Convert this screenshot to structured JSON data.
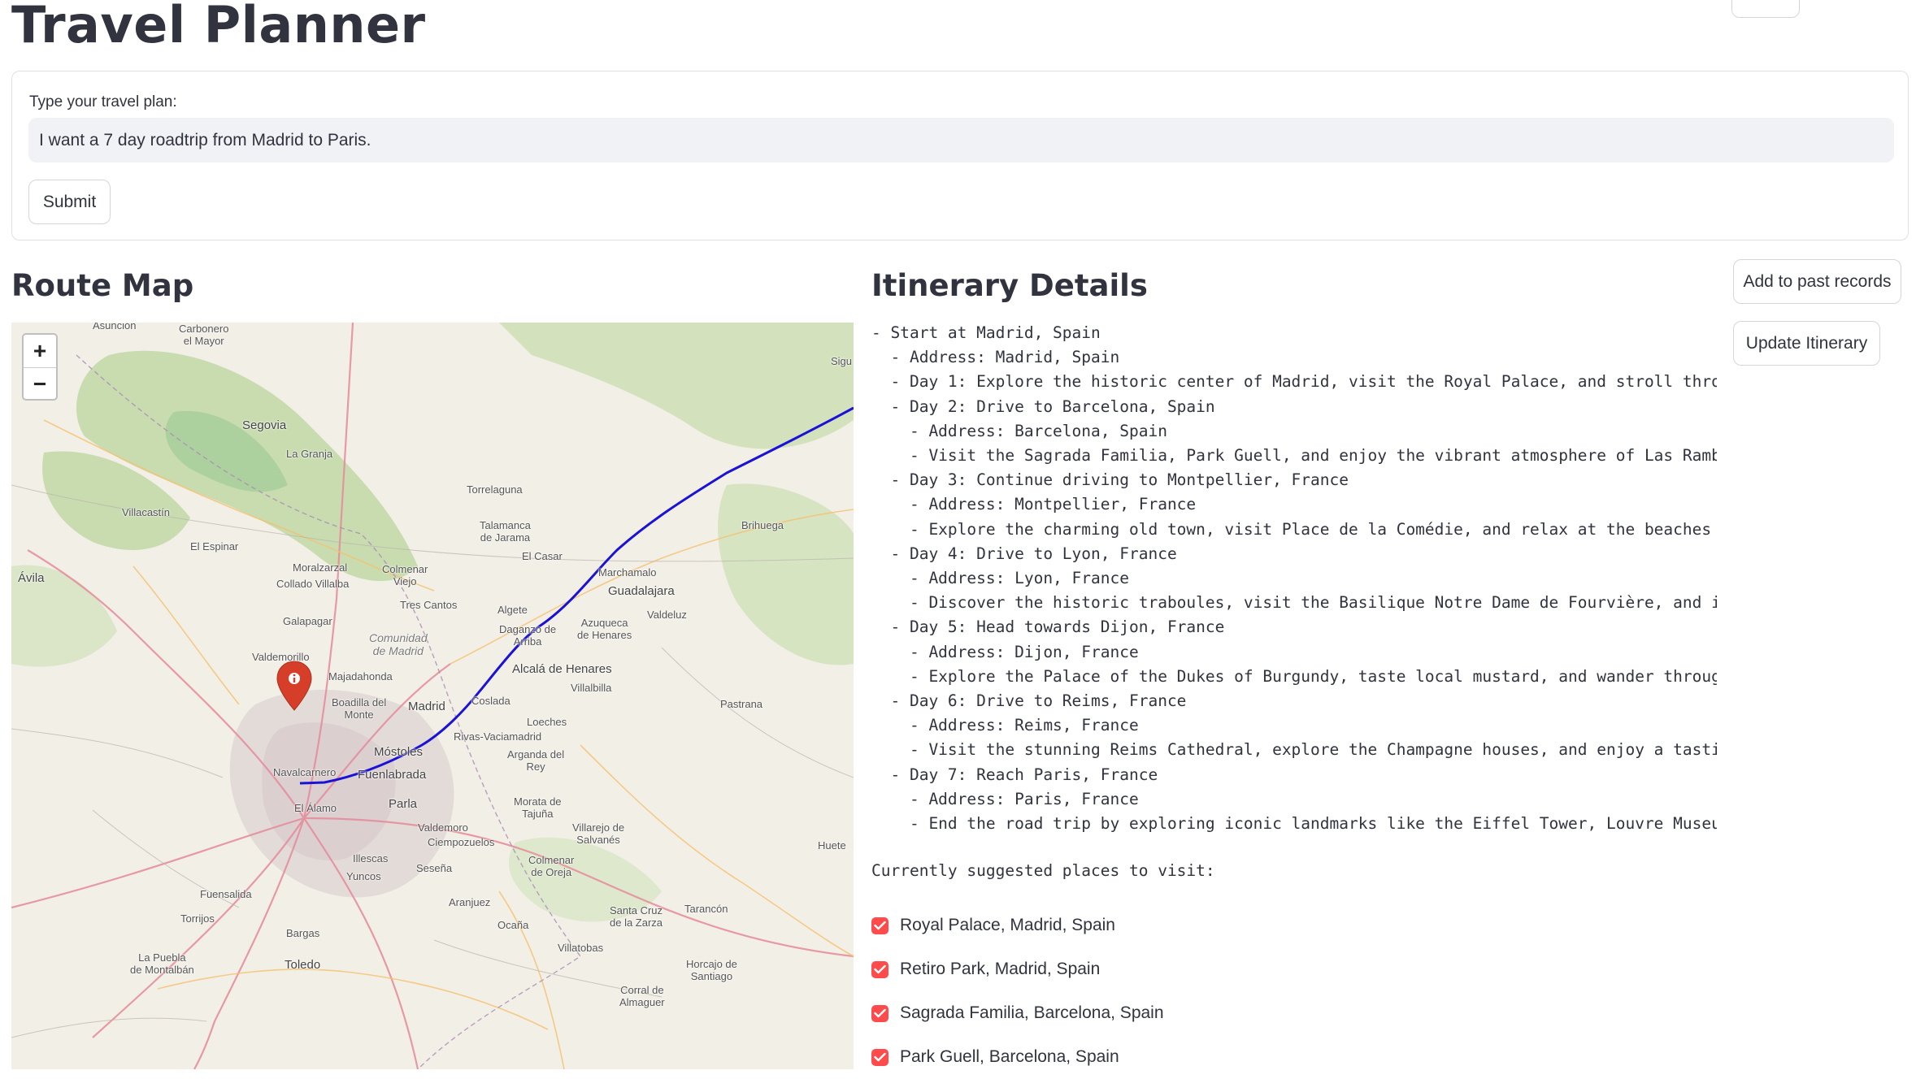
{
  "app": {
    "title": "Travel Planner"
  },
  "form": {
    "label": "Type your travel plan:",
    "input_value": "I want a 7 day roadtrip from Madrid to Paris.",
    "submit_label": "Submit"
  },
  "map_section": {
    "heading": "Route Map",
    "zoom_in": "+",
    "zoom_out": "−",
    "labels": {
      "asuncion": "Asunción",
      "carbonero": "Carbonero\nel Mayor",
      "segovia": "Segovia",
      "la_granja": "La Granja",
      "torrelaguna": "Torrelaguna",
      "talamanca": "Talamanca\nde Jarama",
      "brihuega": "Brihuega",
      "villacastin": "Villacastín",
      "el_espinar": "El Espinar",
      "el_casar": "El Casar",
      "marchamalo": "Marchamalo",
      "guadalajara": "Guadalajara",
      "avila": "Ávila",
      "moralzarzal": "Moralzarzal",
      "colmenar_viejo": "Colmenar\nViejo",
      "collado_villalba": "Collado Villalba",
      "tres_cantos": "Tres Cantos",
      "algete": "Algete",
      "valdeluz": "Valdeluz",
      "galapagar": "Galapagar",
      "comunidad": "Comunidad\nde Madrid",
      "daganzo": "Daganzo de\nArriba",
      "azuqueca": "Azuqueca\nde Henares",
      "valdemorillo": "Valdemorillo",
      "majadahonda": "Majadahonda",
      "alcala": "Alcalá de Henares",
      "boadilla": "Boadilla del\nMonte",
      "madrid": "Madrid",
      "coslada": "Coslada",
      "villalbilla": "Villalbilla",
      "pastrana": "Pastrana",
      "loeches": "Loeches",
      "rivas": "Rivas-Vaciamadrid",
      "mostoles": "Móstoles",
      "navalcarnero": "Navalcarnero",
      "fuenlabrada": "Fuenlabrada",
      "arganda": "Arganda del\nRey",
      "el_alamo": "El Álamo",
      "parla": "Parla",
      "morata": "Morata de\nTajuña",
      "valdemoro": "Valdemoro",
      "ciempozuelos": "Ciempozuelos",
      "villarejo": "Villarejo de\nSalvanés",
      "huete": "Huete",
      "illescas": "Illescas",
      "yuncos": "Yuncos",
      "sesena": "Seseña",
      "colmenar_oreja": "Colmenar\nde Oreja",
      "fuensalida": "Fuensalida",
      "aranjuez": "Aranjuez",
      "torrijos": "Torrijos",
      "santa_cruz": "Santa Cruz\nde la Zarza",
      "tarancon": "Tarancón",
      "bargas": "Bargas",
      "ocana": "Ocaña",
      "villatobas": "Villatobas",
      "la_puebla": "La Puebla\nde Montalbán",
      "toledo": "Toledo",
      "horcajo": "Horcajo de\nSantiago",
      "corral": "Corral de\nAlmaguer",
      "sigu": "Sigu"
    }
  },
  "itinerary": {
    "heading": "Itinerary Details",
    "text": "- Start at Madrid, Spain\n  - Address: Madrid, Spain\n  - Day 1: Explore the historic center of Madrid, visit the Royal Palace, and stroll through\n  - Day 2: Drive to Barcelona, Spain\n    - Address: Barcelona, Spain\n    - Visit the Sagrada Familia, Park Guell, and enjoy the vibrant atmosphere of Las Ramblas\n  - Day 3: Continue driving to Montpellier, France\n    - Address: Montpellier, France\n    - Explore the charming old town, visit Place de la Comédie, and relax at the beaches alo\n  - Day 4: Drive to Lyon, France\n    - Address: Lyon, France\n    - Discover the historic traboules, visit the Basilique Notre Dame de Fourvière, and indu\n  - Day 5: Head towards Dijon, France\n    - Address: Dijon, France\n    - Explore the Palace of the Dukes of Burgundy, taste local mustard, and wander through t\n  - Day 6: Drive to Reims, France\n    - Address: Reims, France\n    - Visit the stunning Reims Cathedral, explore the Champagne houses, and enjoy a tasting\n  - Day 7: Reach Paris, France\n    - Address: Paris, France\n    - End the road trip by exploring iconic landmarks like the Eiffel Tower, Louvre Museum,",
    "suggested_title": "Currently suggested places to visit:",
    "places": [
      {
        "label": "Royal Palace, Madrid, Spain",
        "checked": true
      },
      {
        "label": "Retiro Park, Madrid, Spain",
        "checked": true
      },
      {
        "label": "Sagrada Familia, Barcelona, Spain",
        "checked": true
      },
      {
        "label": "Park Guell, Barcelona, Spain",
        "checked": true
      }
    ]
  },
  "actions": {
    "add_past": "Add to past records",
    "update": "Update Itinerary"
  },
  "colors": {
    "accent": "#ff4b4b",
    "route": "#1a12d6",
    "marker": "#d63e2a"
  }
}
